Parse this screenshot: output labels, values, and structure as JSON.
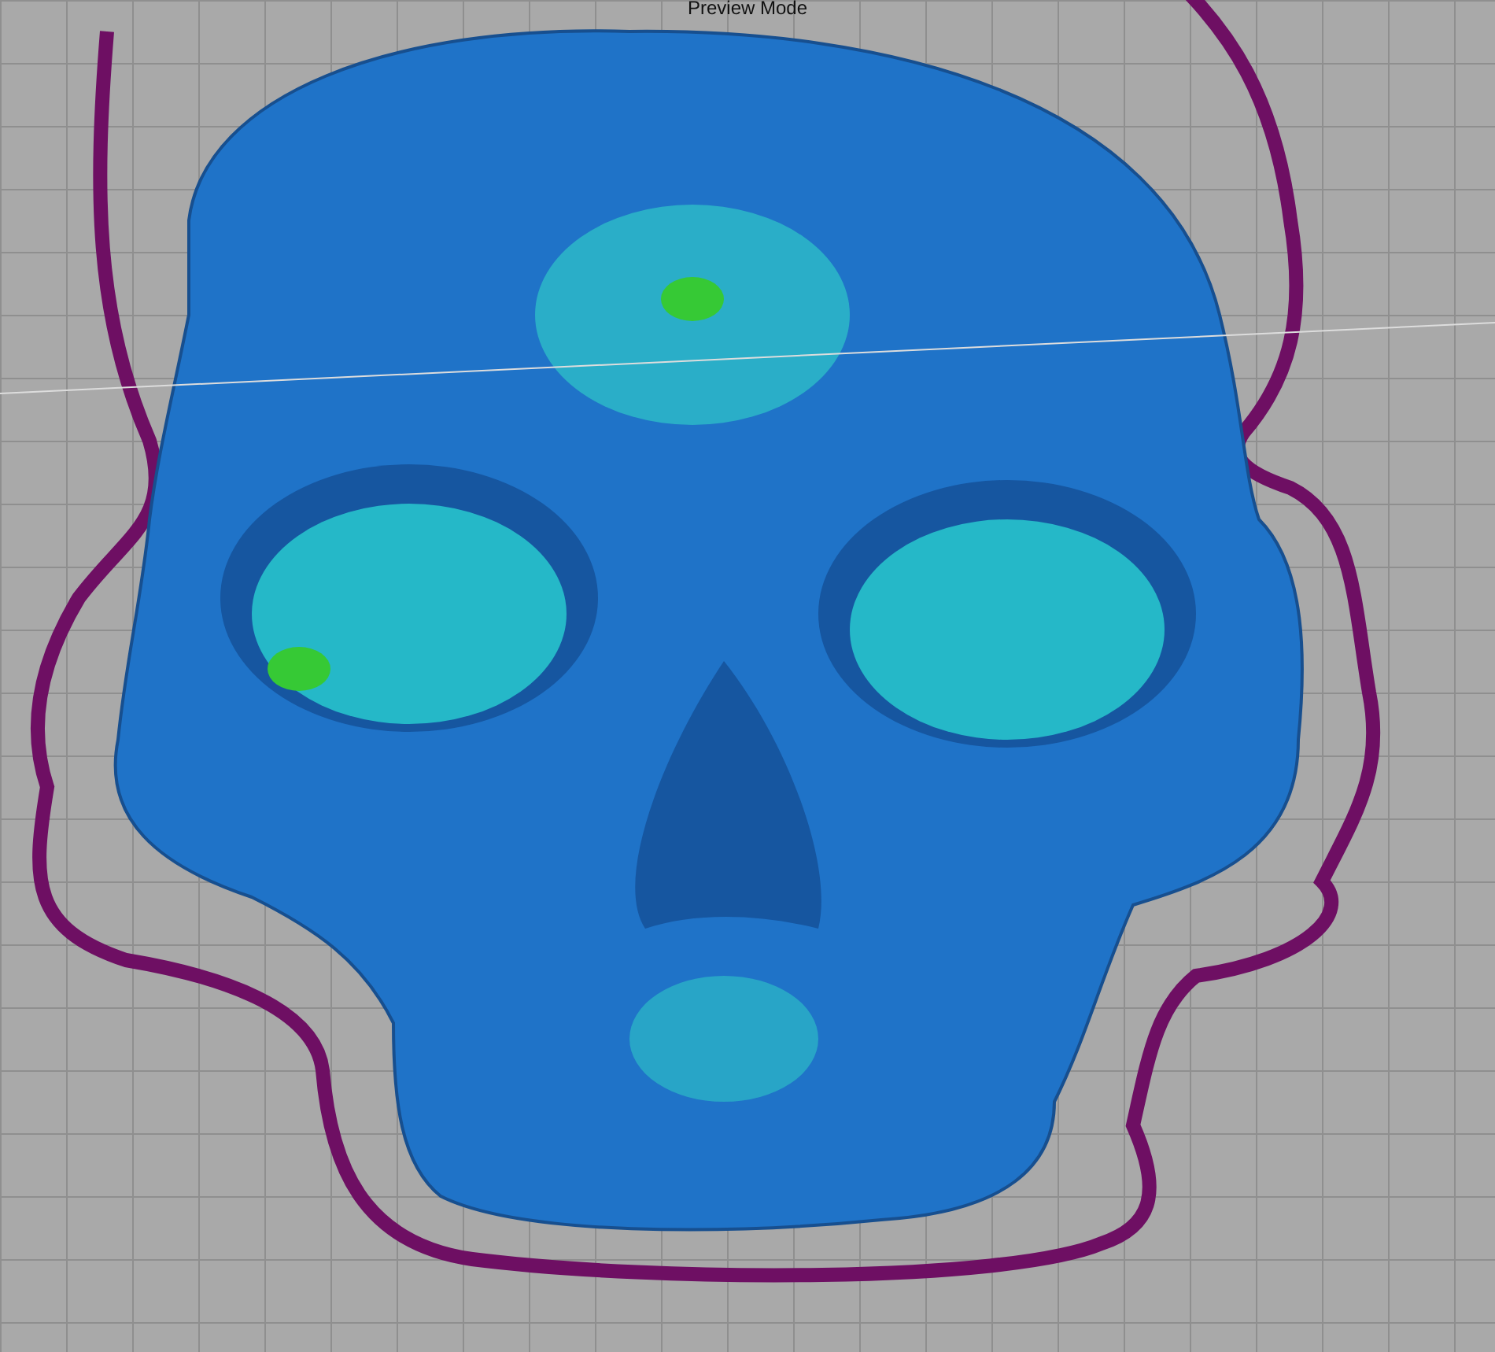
{
  "viewport": {
    "mode_label": "Preview Mode"
  }
}
